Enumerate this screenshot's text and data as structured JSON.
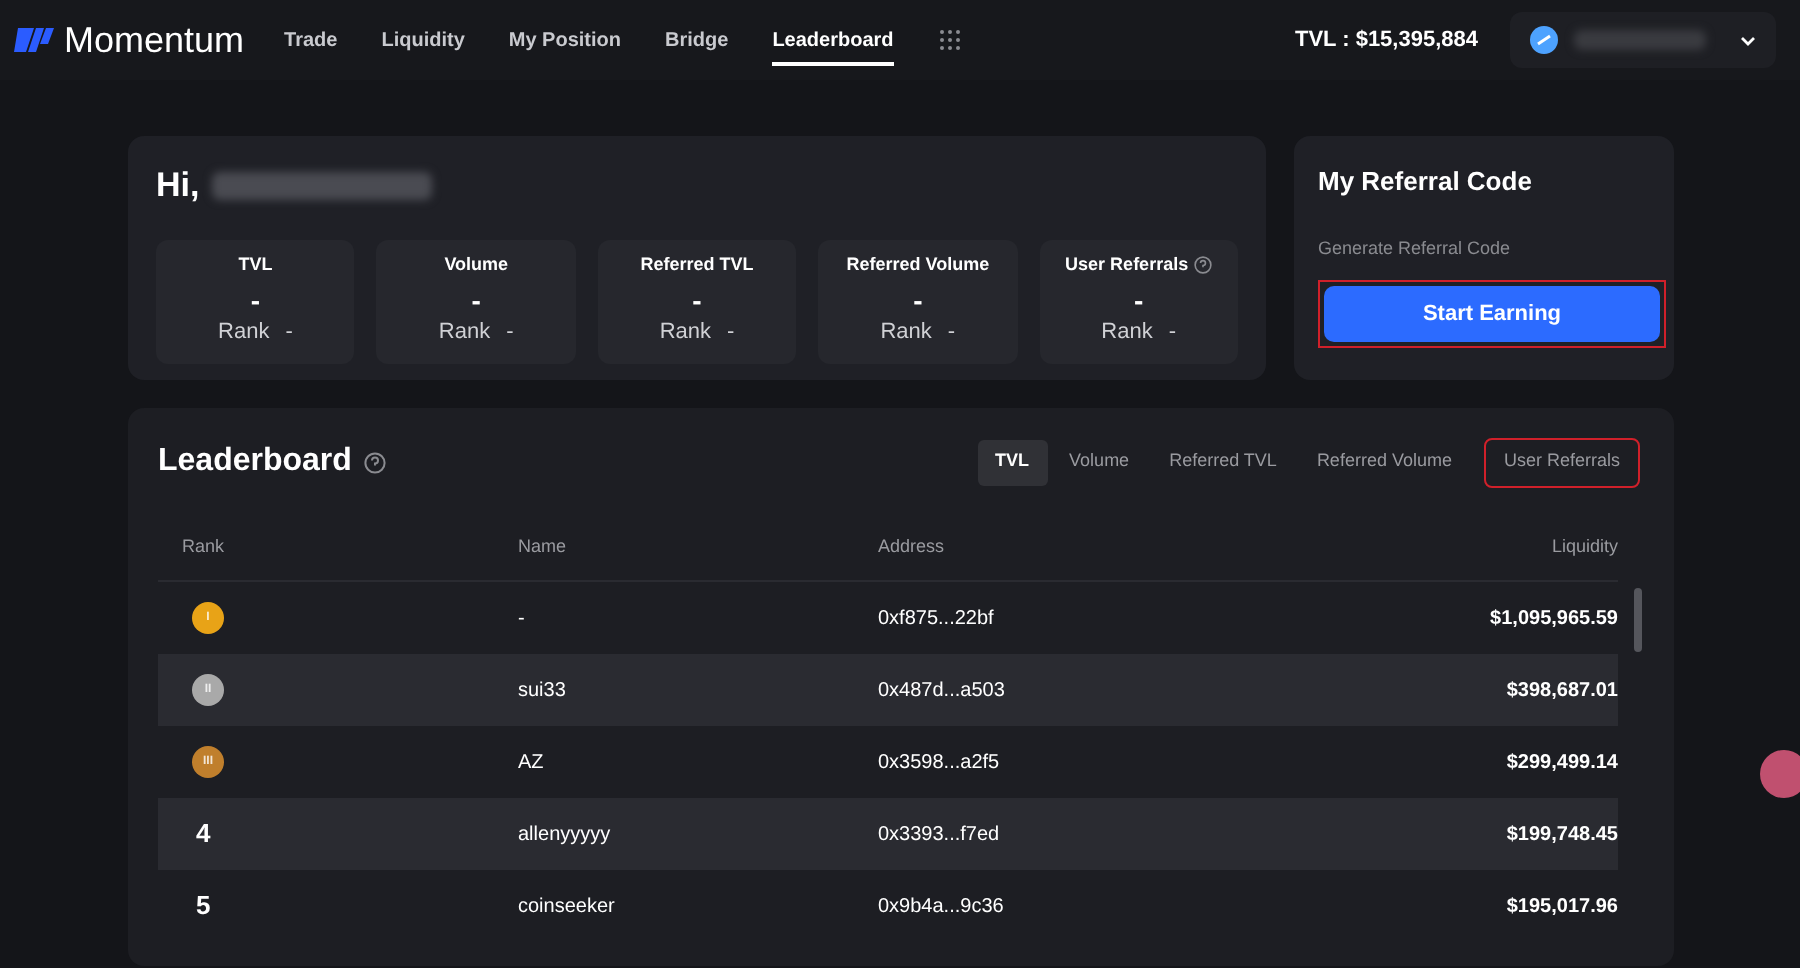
{
  "nav": {
    "brand": "Momentum",
    "links": [
      {
        "label": "Trade",
        "selected": false
      },
      {
        "label": "Liquidity",
        "selected": false
      },
      {
        "label": "My Position",
        "selected": false
      },
      {
        "label": "Bridge",
        "selected": false
      },
      {
        "label": "Leaderboard",
        "selected": true
      }
    ],
    "tvl": "TVL : $15,395,884"
  },
  "profile": {
    "greeting": "Hi,",
    "stats": [
      {
        "label": "TVL",
        "value": "-",
        "rank_label": "Rank",
        "rank": "-",
        "help": false
      },
      {
        "label": "Volume",
        "value": "-",
        "rank_label": "Rank",
        "rank": "-",
        "help": false
      },
      {
        "label": "Referred TVL",
        "value": "-",
        "rank_label": "Rank",
        "rank": "-",
        "help": false
      },
      {
        "label": "Referred Volume",
        "value": "-",
        "rank_label": "Rank",
        "rank": "-",
        "help": false
      },
      {
        "label": "User Referrals",
        "value": "-",
        "rank_label": "Rank",
        "rank": "-",
        "help": true
      }
    ]
  },
  "referral": {
    "title": "My Referral Code",
    "subtitle": "Generate Referral Code",
    "button": {
      "label": "Start Earning",
      "highlighted": true
    }
  },
  "leaderboard": {
    "title": "Leaderboard",
    "tabs": [
      {
        "label": "TVL",
        "selected": true,
        "highlighted": false
      },
      {
        "label": "Volume",
        "selected": false,
        "highlighted": false
      },
      {
        "label": "Referred TVL",
        "selected": false,
        "highlighted": false
      },
      {
        "label": "Referred Volume",
        "selected": false,
        "highlighted": false
      },
      {
        "label": "User Referrals",
        "selected": false,
        "highlighted": true
      }
    ],
    "columns": [
      "Rank",
      "Name",
      "Address",
      "Liquidity"
    ],
    "rows": [
      {
        "rank": {
          "kind": "medal",
          "label": "I",
          "color": "#e8a317"
        },
        "name": "-",
        "address": "0xf875...22bf",
        "liquidity": "$1,095,965.59"
      },
      {
        "rank": {
          "kind": "medal",
          "label": "II",
          "color": "#a9a9a9"
        },
        "name": "sui33",
        "address": "0x487d...a503",
        "liquidity": "$398,687.01"
      },
      {
        "rank": {
          "kind": "medal",
          "label": "III",
          "color": "#c07f2c"
        },
        "name": "AZ",
        "address": "0x3598...a2f5",
        "liquidity": "$299,499.14"
      },
      {
        "rank": {
          "kind": "number",
          "label": "4"
        },
        "name": "allenyyyyy",
        "address": "0x3393...f7ed",
        "liquidity": "$199,748.45"
      },
      {
        "rank": {
          "kind": "number",
          "label": "5"
        },
        "name": "coinseeker",
        "address": "0x9b4a...9c36",
        "liquidity": "$195,017.96"
      }
    ]
  }
}
